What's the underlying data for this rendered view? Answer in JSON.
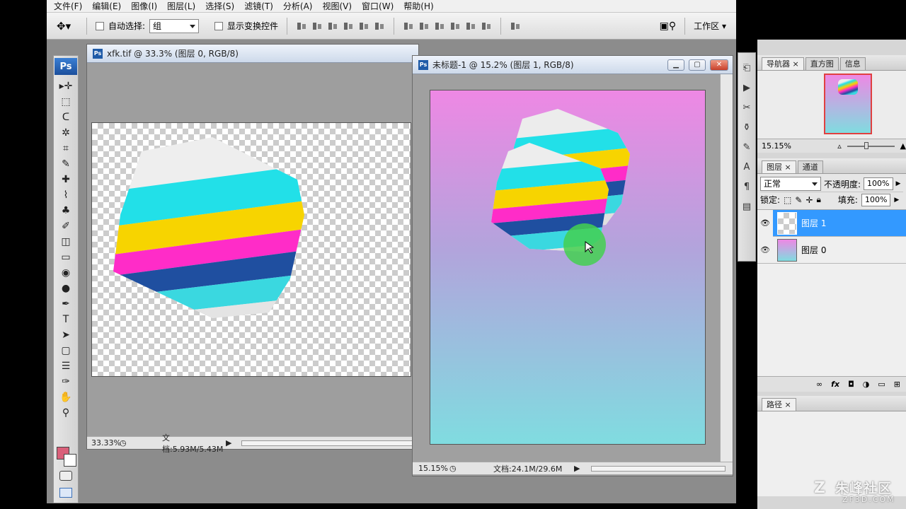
{
  "menu": [
    "文件(F)",
    "编辑(E)",
    "图像(I)",
    "图层(L)",
    "选择(S)",
    "滤镜(T)",
    "分析(A)",
    "视图(V)",
    "窗口(W)",
    "帮助(H)"
  ],
  "options": {
    "auto_select_label": "自动选择:",
    "auto_select_value": "组",
    "show_transform_label": "显示变换控件",
    "workspace_label": "工作区 ▾"
  },
  "tools": [
    "▸✛",
    "⬚",
    "ᑕ",
    "✲",
    "⌗",
    "✎",
    "✚",
    "⌇",
    "♣",
    "✐",
    "◫",
    "▭",
    "◉",
    "●",
    "✒",
    "T",
    "➤",
    "▢",
    "☰",
    "✑",
    "✋",
    "⚲"
  ],
  "doc1": {
    "title": "xfk.tif @ 33.3% (图层 0, RGB/8)",
    "zoom": "33.33%",
    "doc_size": "文档:5.93M/5.43M"
  },
  "doc2": {
    "title": "未标题-1 @ 15.2% (图层 1, RGB/8)",
    "zoom": "15.15%",
    "doc_size": "文档:24.1M/29.6M"
  },
  "navigator": {
    "tabs": [
      "导航器",
      "直方图",
      "信息"
    ],
    "zoom": "15.15%"
  },
  "layers": {
    "tabs": [
      "图层",
      "通道"
    ],
    "blend_mode": "正常",
    "opacity_label": "不透明度:",
    "opacity_value": "100%",
    "lock_label": "锁定:",
    "fill_label": "填充:",
    "fill_value": "100%",
    "items": [
      {
        "name": "图层 1",
        "selected": true
      },
      {
        "name": "图层 0",
        "selected": false
      }
    ],
    "footer_icons": [
      "∞",
      "fx",
      "◘",
      "◑",
      "▭",
      "⊞"
    ]
  },
  "paths": {
    "tabs": [
      "路径"
    ]
  },
  "watermark": {
    "brand": "朱峰社区",
    "site": "ZF3D.COM"
  },
  "colors": {
    "foreground": "#d9607a",
    "background": "#ffffff",
    "selection": "#3399ff"
  }
}
